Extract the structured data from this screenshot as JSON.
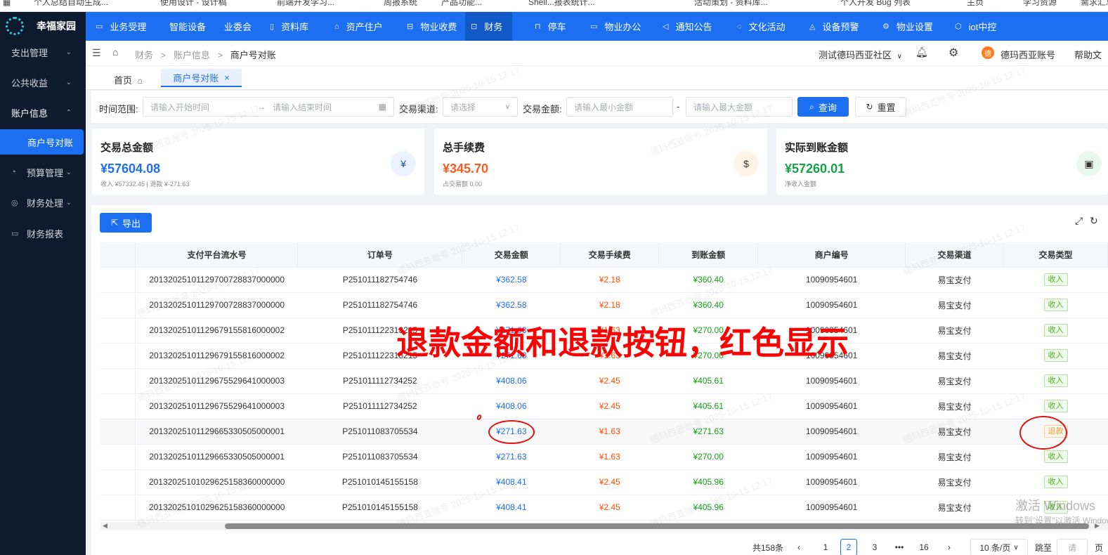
{
  "bookmarks": [
    "个人总结自动生成...",
    "使用设计 - 设计稿",
    "前端开发学习...",
    "周报系统",
    "产品功能...",
    "Shell...报表统计...",
    "活动策划 - 资料库...",
    "个人开发 Bug 列表",
    "主页",
    "学习资源",
    "需求汇总"
  ],
  "app": {
    "name": "幸福家园"
  },
  "sidebar": {
    "items": [
      {
        "label": "支出管理",
        "chev": "⌄"
      },
      {
        "label": "公共收益",
        "chev": "⌄"
      },
      {
        "label": "账户信息",
        "chev": "⌃"
      },
      {
        "label": "商户号对账"
      },
      {
        "label": "预算管理",
        "chev": "⌄"
      },
      {
        "label": "财务处理",
        "chev": "⌄"
      },
      {
        "label": "财务报表"
      }
    ]
  },
  "nav": {
    "items": [
      "业务受理",
      "智能设备",
      "业委会",
      "资料库",
      "资产住户",
      "物业收费",
      "财务",
      "停车",
      "物业办公",
      "通知公告",
      "文化活动",
      "设备预警",
      "物业设置",
      "iot中控"
    ]
  },
  "breadcrumb": [
    "财务",
    "账户信息",
    "商户号对账"
  ],
  "header": {
    "community": "测试德玛西亚社区",
    "account": "德玛西亚账号",
    "avatar_text": "德",
    "help": "帮助文"
  },
  "tabs": {
    "home": "首页",
    "active": "商户号对账",
    "close": "×"
  },
  "filter": {
    "time_label": "时间范围:",
    "start_placeholder": "请输入开始时间",
    "arrow": "→",
    "end_placeholder": "请输入结束时间",
    "channel_label": "交易渠道:",
    "channel_placeholder": "请选择",
    "amount_label": "交易金额:",
    "min_placeholder": "请输入最小金额",
    "dash": "-",
    "max_placeholder": "请输入最大金额",
    "query": "查询",
    "reset": "重置"
  },
  "cards": [
    {
      "title": "交易总金额",
      "value": "¥57604.08",
      "sub": "收入 ¥57332.45 | 退款 ¥-271.63",
      "color": "#1d6ff2"
    },
    {
      "title": "总手续费",
      "value": "¥345.70",
      "sub": "占交易额 0.00",
      "color": "#ff5a1f"
    },
    {
      "title": "实际到账金额",
      "value": "¥57260.01",
      "sub": "净收入金额",
      "color": "#13a340"
    }
  ],
  "table": {
    "export": "导出",
    "columns": [
      "支付平台流水号",
      "订单号",
      "交易金额",
      "交易手续费",
      "到账金额",
      "商户编号",
      "交易渠道",
      "交易类型"
    ],
    "rows": [
      [
        "20132025101129700728837000000",
        "P251011182754746",
        "¥362.58",
        "¥2.18",
        "¥360.40",
        "10090954601",
        "易宝支付",
        "收入"
      ],
      [
        "20132025101129700728837000000",
        "P251011182754746",
        "¥362.58",
        "¥2.18",
        "¥360.40",
        "10090954601",
        "易宝支付",
        "收入"
      ],
      [
        "20132025101129679155816000002",
        "P251011122313215",
        "¥271.63",
        "¥1.63",
        "¥270.00",
        "10090954601",
        "易宝支付",
        "收入"
      ],
      [
        "20132025101129679155816000002",
        "P251011122313215",
        "¥271.63",
        "¥1.63",
        "¥270.00",
        "10090954601",
        "易宝支付",
        "收入"
      ],
      [
        "20132025101129675529641000003",
        "P251011112734252",
        "¥408.06",
        "¥2.45",
        "¥405.61",
        "10090954601",
        "易宝支付",
        "收入"
      ],
      [
        "20132025101129675529641000003",
        "P251011112734252",
        "¥408.06",
        "¥2.45",
        "¥405.61",
        "10090954601",
        "易宝支付",
        "收入"
      ],
      [
        "20132025101129665330505000001",
        "P251011083705534",
        "¥271.63",
        "¥1.63",
        "¥271.63",
        "10090954601",
        "易宝支付",
        "退款"
      ],
      [
        "20132025101129665330505000001",
        "P251011083705534",
        "¥271.63",
        "¥1.63",
        "¥270.00",
        "10090954601",
        "易宝支付",
        "收入"
      ],
      [
        "20132025101029625158360000000",
        "P251010145155158",
        "¥408.41",
        "¥2.45",
        "¥405.96",
        "10090954601",
        "易宝支付",
        "收入"
      ],
      [
        "20132025101029625158360000000",
        "P251010145155158",
        "¥408.41",
        "¥2.45",
        "¥405.96",
        "10090954601",
        "易宝支付",
        "收入"
      ]
    ]
  },
  "annotation": {
    "text": "退款金额和退款按钮，红色显示"
  },
  "pagination": {
    "total": "共158条",
    "prev": "‹",
    "pages": [
      "1",
      "2",
      "3",
      "•••",
      "16"
    ],
    "current": "2",
    "next": "›",
    "size": "10 条/页",
    "jump": "跳至",
    "jump_placeholder": "请",
    "page_suffix": "页"
  },
  "watermark": {
    "text": "德玛西亚账号 2025-10-15 12:17"
  },
  "windows": {
    "line1": "激活 Windows",
    "line2": "转到\"设置\"以激活 Windows。"
  }
}
